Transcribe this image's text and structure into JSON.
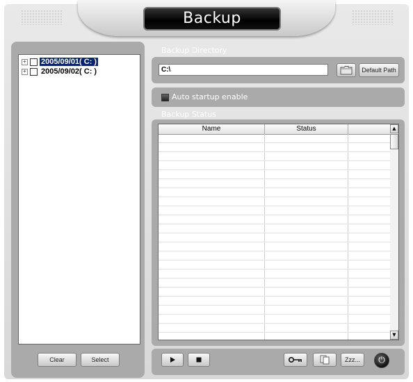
{
  "window": {
    "title": "Backup"
  },
  "tree": {
    "items": [
      {
        "label": "2005/09/01( C: )",
        "selected": true
      },
      {
        "label": "2005/09/02( C: )",
        "selected": false
      }
    ]
  },
  "left_buttons": {
    "clear": "Clear",
    "select": "Select"
  },
  "backup_directory": {
    "label": "Backup Directory",
    "value": "C:\\",
    "default_path": "Default Path"
  },
  "auto_startup": {
    "label": "Auto startup enable",
    "checked": true
  },
  "backup_status": {
    "label": "Backup Status",
    "columns": [
      "Name",
      "Status",
      ""
    ],
    "rows": []
  },
  "controls": {
    "play_icon": "play-icon",
    "stop_icon": "stop-icon",
    "key_icon": "key-icon",
    "copy_icon": "copy-icon",
    "sleep_label": "Zzz...",
    "power_icon": "power-icon"
  }
}
